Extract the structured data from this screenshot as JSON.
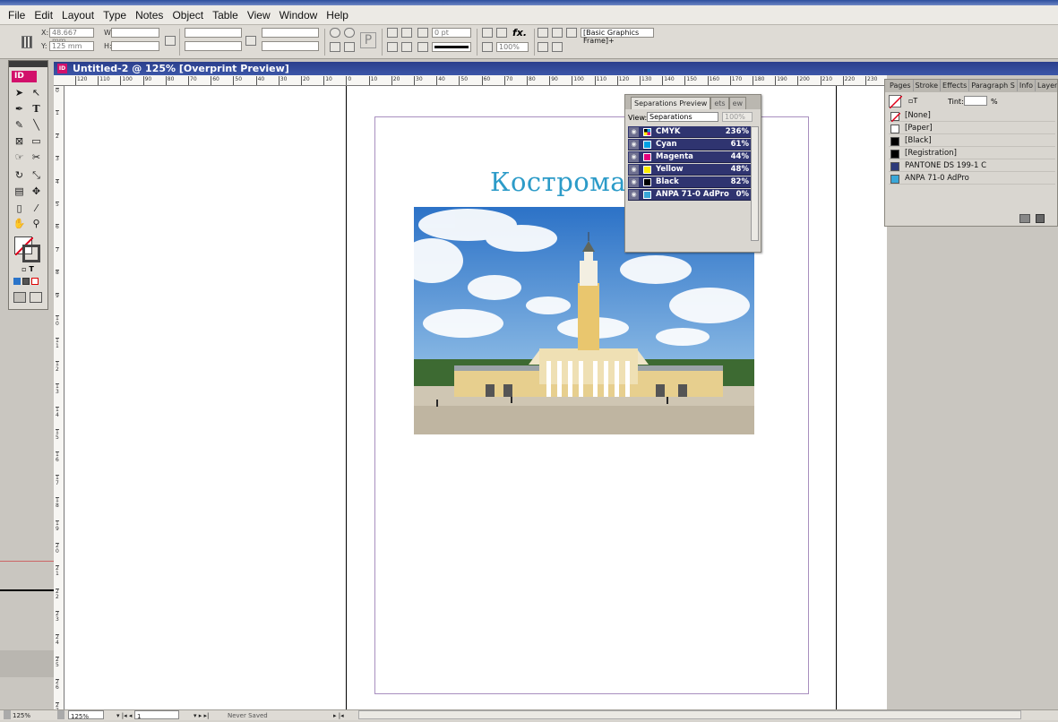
{
  "menu": [
    "File",
    "Edit",
    "Layout",
    "Type",
    "Notes",
    "Object",
    "Table",
    "View",
    "Window",
    "Help"
  ],
  "control_bar": {
    "x_label": "X:",
    "x_value": "48.667 mm",
    "y_label": "Y:",
    "y_value": "125 mm",
    "w_label": "W:",
    "h_label": "H:",
    "stroke_weight": "0 pt",
    "opacity": "100%",
    "frame_style": "[Basic Graphics Frame]+"
  },
  "document": {
    "tab_title": "Untitled-2 @ 125% [Overprint Preview]",
    "heading": "Кострома"
  },
  "ruler": {
    "h_ticks": [
      "120",
      "110",
      "100",
      "90",
      "80",
      "70",
      "60",
      "50",
      "40",
      "30",
      "20",
      "10",
      "0",
      "10",
      "20",
      "30",
      "40",
      "50",
      "60",
      "70",
      "80",
      "90",
      "100",
      "110",
      "120",
      "130",
      "140",
      "150",
      "160",
      "170",
      "180",
      "190",
      "200",
      "210",
      "220",
      "230"
    ],
    "v_ticks": [
      "0",
      "1",
      "2",
      "3",
      "4",
      "5",
      "6",
      "7",
      "8",
      "9",
      "1\n0",
      "1\n1",
      "1\n2",
      "1\n3",
      "1\n4",
      "1\n5",
      "1\n6",
      "1\n7",
      "1\n8",
      "1\n9",
      "2\n0",
      "2\n1",
      "2\n2",
      "2\n3",
      "2\n4",
      "2\n5",
      "2\n6",
      "2\n7"
    ]
  },
  "separations_panel": {
    "tabs": [
      "Separations Preview",
      "ets",
      "ew"
    ],
    "view_label": "View:",
    "view_value": "Separations",
    "zoom": "100%",
    "rows": [
      {
        "name": "CMYK",
        "pct": "236%",
        "color": "cmyk"
      },
      {
        "name": "Cyan",
        "pct": "61%",
        "color": "#00a0e3"
      },
      {
        "name": "Magenta",
        "pct": "44%",
        "color": "#e4007d"
      },
      {
        "name": "Yellow",
        "pct": "48%",
        "color": "#ffed00"
      },
      {
        "name": "Black",
        "pct": "82%",
        "color": "#000000"
      },
      {
        "name": "ANPA 71-0 AdPro",
        "pct": "0%",
        "color": "#3aa7d8"
      }
    ]
  },
  "swatches_panel": {
    "tabs": [
      "Pages",
      "Stroke",
      "Effects",
      "Paragraph S",
      "Info",
      "Layers"
    ],
    "tint_label": "Tint:",
    "tint_unit": "%",
    "rows": [
      {
        "name": "[None]",
        "color": "none"
      },
      {
        "name": "[Paper]",
        "color": "#ffffff"
      },
      {
        "name": "[Black]",
        "color": "#000000"
      },
      {
        "name": "[Registration]",
        "color": "#000000"
      },
      {
        "name": "PANTONE DS 199-1 C",
        "color": "#2d3a7a"
      },
      {
        "name": "ANPA 71-0 AdPro",
        "color": "#3aa7d8"
      }
    ]
  },
  "status": {
    "left_zoom": "125%",
    "zoom": "125%",
    "page": "1",
    "save_state": "Never Saved"
  }
}
